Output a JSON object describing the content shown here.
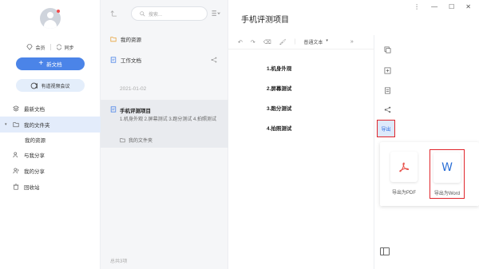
{
  "sidebar": {
    "member_label": "会员",
    "sync_label": "同步",
    "new_doc_label": "新文档",
    "meeting_label": "有道视频会议",
    "nav": [
      {
        "label": "最新文档"
      },
      {
        "label": "我的文件夹"
      },
      {
        "label": "我的资源"
      },
      {
        "label": "与我分享"
      },
      {
        "label": "我的分享"
      },
      {
        "label": "回收站"
      }
    ]
  },
  "list": {
    "search_placeholder": "搜索...",
    "items": [
      {
        "label": "我的资源"
      },
      {
        "label": "工作文档"
      }
    ],
    "date": "2021-01-02",
    "selected": {
      "title": "手机评测项目",
      "desc": "1.机身外观 2.屏幕测试 3.跑分测试 4.拍照测试",
      "folder": "我的文件夹"
    },
    "footer": "总共3项"
  },
  "editor": {
    "title": "手机评测项目",
    "style_select": "普通文本",
    "lines": [
      "1.机身外观",
      "2.屏幕测试",
      "3.跑分测试",
      "4.拍照测试"
    ],
    "export_label": "导出",
    "export_pdf_label": "导出为PDF",
    "export_word_label": "导出为Word"
  },
  "colors": {
    "accent": "#4b84e8",
    "highlight_border": "#e0252b",
    "pdf_red": "#e8514a",
    "word_blue": "#2b6fd6"
  }
}
